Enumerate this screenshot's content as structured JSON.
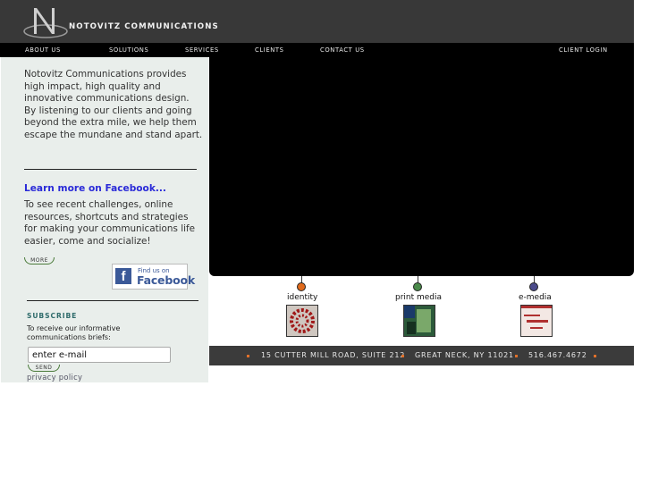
{
  "brand": {
    "name": "NOTOVITZ COMMUNICATIONS",
    "logo_letter": "N"
  },
  "nav": {
    "items": [
      "ABOUT US",
      "SOLUTIONS",
      "SERVICES",
      "CLIENTS",
      "CONTACT US"
    ],
    "login": "CLIENT LOGIN"
  },
  "sidebar": {
    "intro": "Notovitz Communications provides high impact, high quality and innovative communications design. By listening to our clients and going beyond the extra mile, we help them escape the mundane and stand apart.",
    "facebook_link": "Learn more on Facebook...",
    "facebook_text": "To see recent challenges, online resources, shortcuts and strategies for making your communications life easier, come and socialize!",
    "more_label": "MORE",
    "fb_badge": {
      "line1": "Find us on",
      "line2": "Facebook",
      "f": "f"
    },
    "subscribe": {
      "title": "SUBSCRIBE",
      "text": "To receive our informative communications briefs:",
      "email_value": "enter e-mail",
      "send_label": "SEND",
      "privacy": "privacy policy"
    }
  },
  "categories": [
    {
      "label": "identity",
      "dot_color": "#e06a1c"
    },
    {
      "label": "print media",
      "dot_color": "#4a8a4a"
    },
    {
      "label": "e-media",
      "dot_color": "#4a4a8a"
    }
  ],
  "footer": {
    "address": "15 CUTTER MILL ROAD, SUITE 212",
    "city": "GREAT NECK, NY 11021",
    "phone": "516.467.4672"
  },
  "colors": {
    "header_bg": "#383838",
    "nav_bg": "#000000",
    "sidebar_bg": "#e9eeeb",
    "link": "#2a2ad8",
    "accent": "#e06a1c"
  }
}
